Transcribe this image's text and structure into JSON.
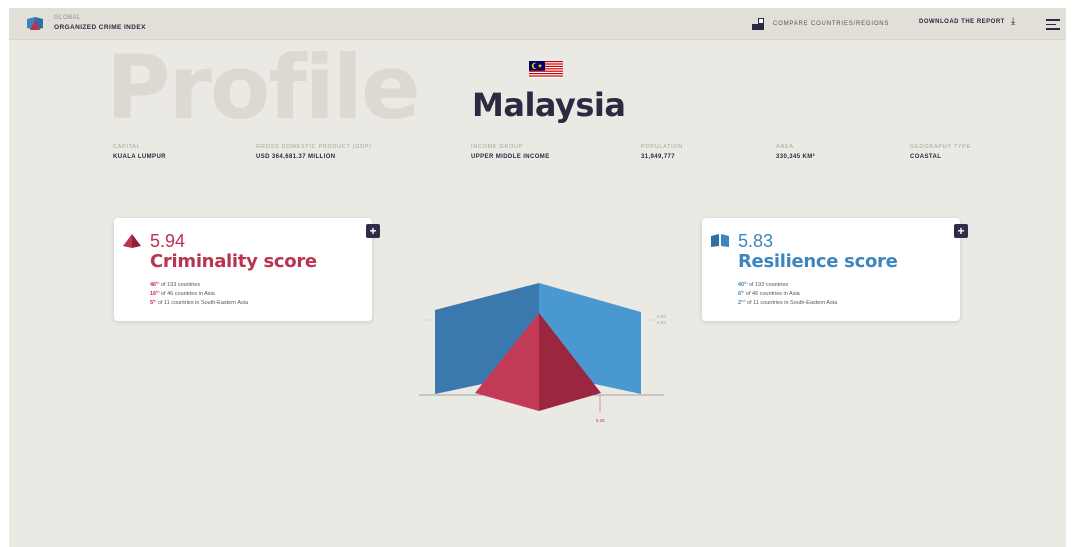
{
  "header": {
    "logo_small": "GLOBAL",
    "logo_big": "ORGANIZED CRIME INDEX",
    "compare_label": "COMPARE COUNTRIES/REGIONS",
    "download_label": "DOWNLOAD THE REPORT",
    "download_icon": "download-arrow-icon",
    "menu_icon": "hamburger-menu-icon"
  },
  "hero": {
    "background_word": "Profile",
    "country": "Malaysia",
    "flag_icon": "malaysia-flag-icon"
  },
  "facts": [
    {
      "label": "CAPITAL",
      "value": "KUALA LUMPUR"
    },
    {
      "label": "GROSS DOMESTIC PRODUCT (GDP)",
      "value": "USD 364,681.37 MILLION"
    },
    {
      "label": "INCOME GROUP",
      "value": "UPPER MIDDLE INCOME"
    },
    {
      "label": "POPULATION",
      "value": "31,949,777"
    },
    {
      "label": "AREA",
      "value": "330,345 KM²"
    },
    {
      "label": "GEOGRAPHY TYPE",
      "value": "COASTAL"
    }
  ],
  "criminality": {
    "score": "5.94",
    "title": "Criminality score",
    "icon": "pyramid-icon",
    "ranks": [
      {
        "pos": "46",
        "suffix": "th",
        "text": " of 193 countries"
      },
      {
        "pos": "16",
        "suffix": "th",
        "text": " of 46 countries in Asia"
      },
      {
        "pos": "5",
        "suffix": "th",
        "text": " of 11 countries in South-Eastern Asia"
      }
    ]
  },
  "resilience": {
    "score": "5.83",
    "title": "Resilience score",
    "icon": "open-book-icon",
    "ranks": [
      {
        "pos": "40",
        "suffix": "th",
        "text": " of 193 countries"
      },
      {
        "pos": "6",
        "suffix": "th",
        "text": " of 46 countries in Asia"
      },
      {
        "pos": "2",
        "suffix": "nd",
        "text": " of 11 countries in South-Eastern Asia"
      }
    ]
  },
  "chart_notes": {
    "right_top": "5.83",
    "right_bottom": "5.83",
    "bottom": "6.25"
  },
  "colors": {
    "background": "#ebe9e4",
    "header": "#e2dfd9",
    "navy": "#2a2a40",
    "criminality": "#b8344f",
    "resilience": "#3d86bd"
  }
}
